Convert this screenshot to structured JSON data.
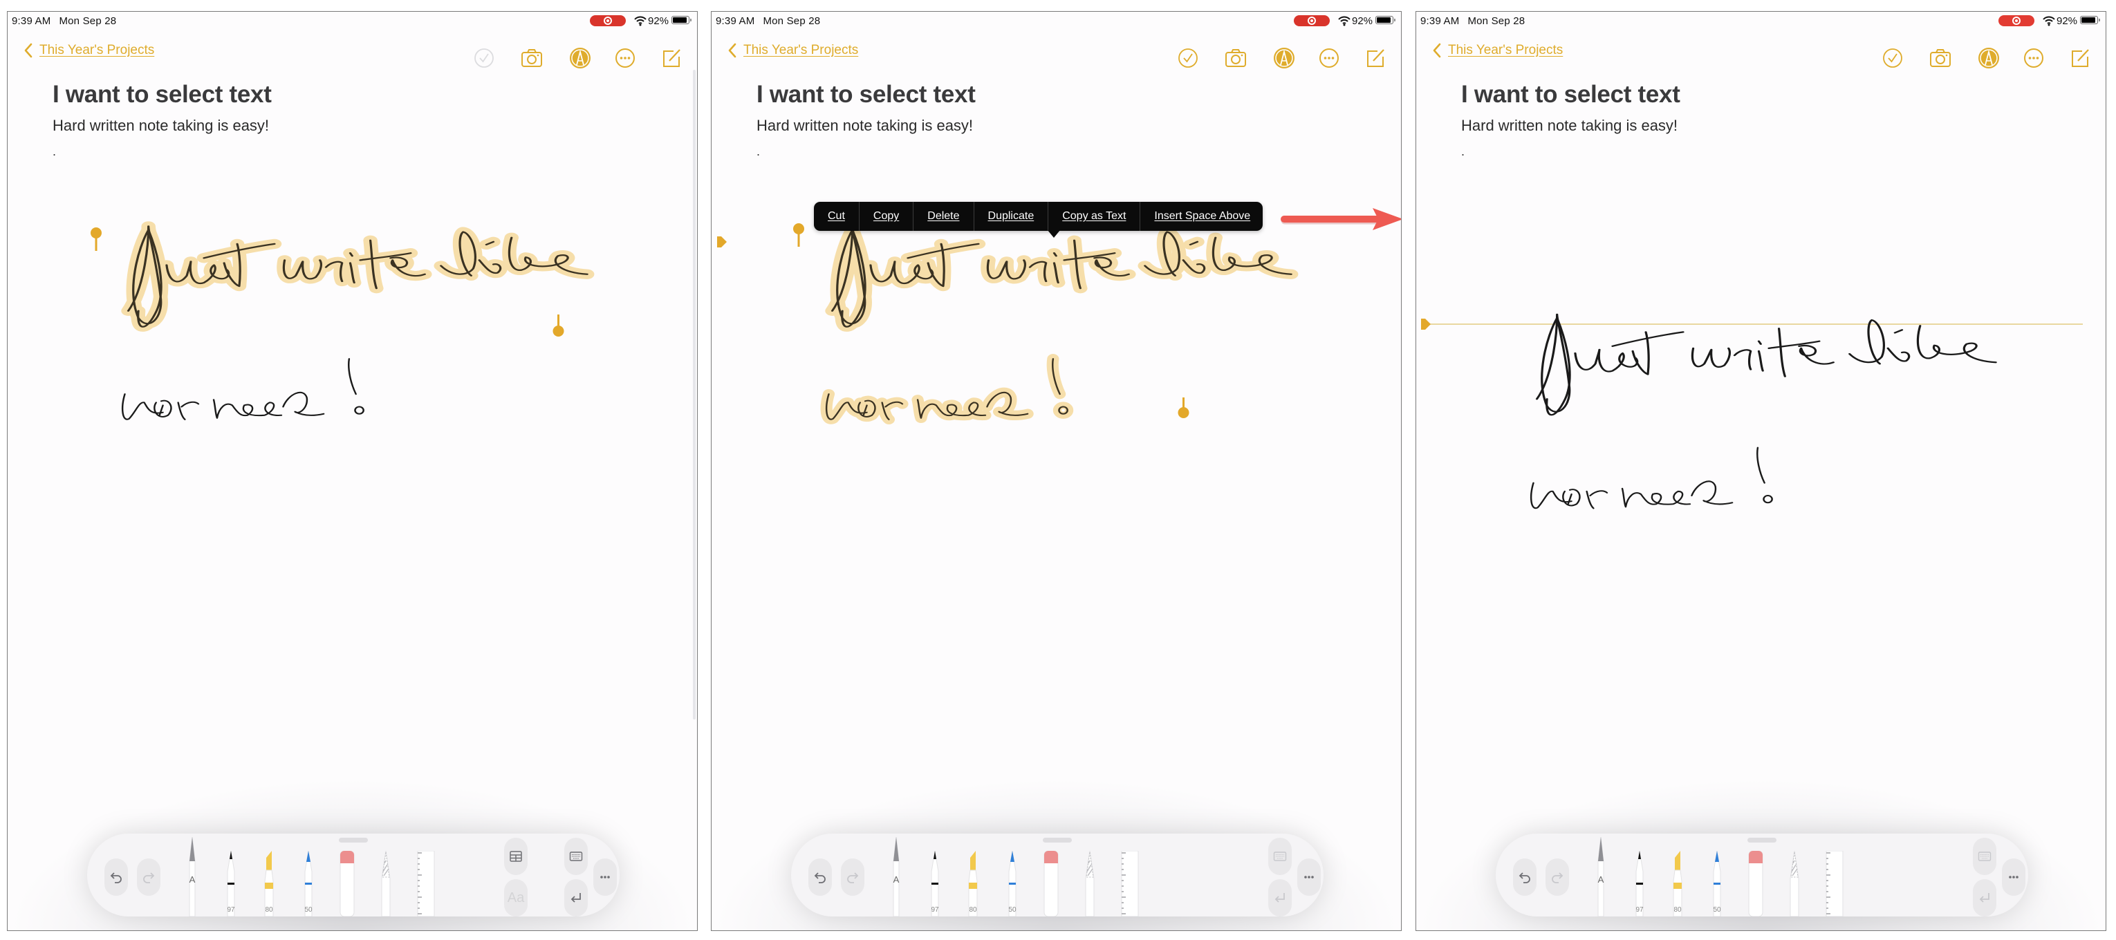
{
  "colors": {
    "accent": "#dfac2c",
    "handle": "#e3a82a",
    "selection_glow": "#f6deaa",
    "ink": "#1a1a1a",
    "menu_bg": "#0b0b0b",
    "annotation_arrow": "#ee5a52",
    "recording": "#d9342b"
  },
  "status_bar": {
    "time": "9:39 AM",
    "date": "Mon Sep 28",
    "battery_percent": "92%",
    "battery_level": 0.92,
    "recording_icon": "screen-recording-icon",
    "wifi_icon": "wifi-icon"
  },
  "nav": {
    "back_label": "This Year's Projects",
    "icons": [
      "checklist-icon",
      "camera-icon",
      "markup-pen-icon",
      "more-ellipsis-icon",
      "compose-icon"
    ]
  },
  "note": {
    "title": "I want to select text",
    "body": "Hard written note taking is easy!",
    "trailing_dot": ".",
    "handwriting_line1": "Just write like",
    "handwriting_line2": "normal !"
  },
  "panels": [
    {
      "state": "handwriting-line1-selected",
      "checklist_enabled": false,
      "selection": "line 1",
      "context_menu_visible": false
    },
    {
      "state": "all-handwriting-selected-context-menu",
      "checklist_enabled": true,
      "selection": "lines 1-2",
      "context_menu_visible": true
    },
    {
      "state": "space-inserted-above",
      "checklist_enabled": true,
      "selection": "none",
      "context_menu_visible": false
    }
  ],
  "context_menu": {
    "items": [
      "Cut",
      "Copy",
      "Delete",
      "Duplicate",
      "Copy as Text",
      "Insert Space Above"
    ],
    "highlighted_item": "Insert Space Above"
  },
  "toolbar": {
    "undo_icon": "undo-icon",
    "redo_icon": "redo-icon",
    "tools": [
      {
        "name": "handwriting-pencil",
        "label": "A"
      },
      {
        "name": "pen",
        "label": "97",
        "color": "#111111"
      },
      {
        "name": "marker",
        "label": "80",
        "color": "#f2c94c"
      },
      {
        "name": "pencil",
        "label": "50",
        "color": "#2f7fd8"
      },
      {
        "name": "eraser",
        "label": ""
      },
      {
        "name": "lasso",
        "label": ""
      },
      {
        "name": "ruler",
        "label": ""
      }
    ],
    "table_icon": "table-icon",
    "format_label": "Aa",
    "keyboard_icon": "keyboard-icon",
    "return_icon": "return-icon",
    "more_icon": "more-ellipsis-icon"
  }
}
